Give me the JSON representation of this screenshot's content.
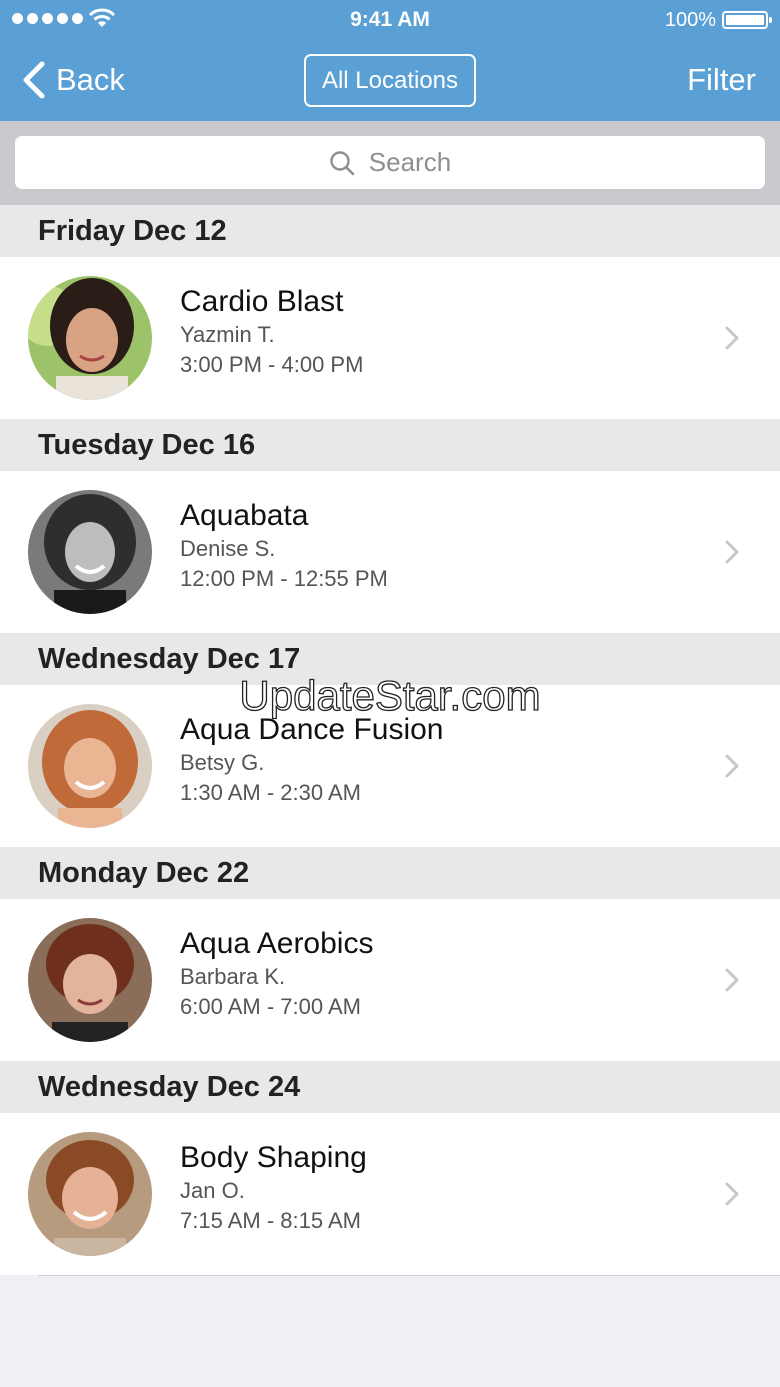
{
  "status_bar": {
    "time": "9:41 AM",
    "battery": "100%"
  },
  "nav": {
    "back_label": "Back",
    "locations_label": "All Locations",
    "filter_label": "Filter"
  },
  "search": {
    "placeholder": "Search"
  },
  "sections": [
    {
      "header": "Friday Dec 12",
      "item": {
        "class": "Cardio Blast",
        "instructor": "Yazmin T.",
        "time": "3:00 PM - 4:00 PM"
      }
    },
    {
      "header": "Tuesday Dec 16",
      "item": {
        "class": "Aquabata",
        "instructor": "Denise S.",
        "time": "12:00 PM - 12:55 PM"
      }
    },
    {
      "header": "Wednesday Dec 17",
      "item": {
        "class": "Aqua Dance Fusion",
        "instructor": "Betsy G.",
        "time": "1:30 AM - 2:30 AM"
      }
    },
    {
      "header": "Monday Dec 22",
      "item": {
        "class": "Aqua Aerobics",
        "instructor": "Barbara K.",
        "time": "6:00 AM - 7:00 AM"
      }
    },
    {
      "header": "Wednesday Dec 24",
      "item": {
        "class": "Body Shaping",
        "instructor": "Jan O.",
        "time": "7:15 AM - 8:15 AM"
      }
    }
  ],
  "watermark": "UpdateStar.com",
  "colors": {
    "nav_bar": "#5aa0d4",
    "section_header_bg": "#e8e8ea"
  }
}
